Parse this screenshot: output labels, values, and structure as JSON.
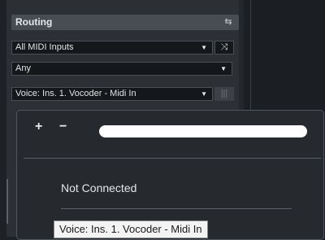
{
  "routing": {
    "title": "Routing",
    "route_icon": "routing-icon",
    "midi_input": "All MIDI Inputs",
    "midi_input_button_icon": "shuffle-icon",
    "channel": "Any",
    "output": "Voice: Ins. 1. Vocoder - Midi In",
    "output_button_icon": "keyboard-icon"
  },
  "popup": {
    "add_label": "+",
    "remove_label": "−",
    "search_placeholder": "",
    "items": [
      "Not Connected"
    ]
  },
  "tooltip": {
    "text": "Voice: Ins. 1. Vocoder - Midi In"
  },
  "colors": {
    "panel_bg": "#2c3034",
    "header_bg": "#484d53",
    "field_bg": "#15181b",
    "popup_bg": "#262a2e",
    "tooltip_bg": "#f3f3f3"
  }
}
